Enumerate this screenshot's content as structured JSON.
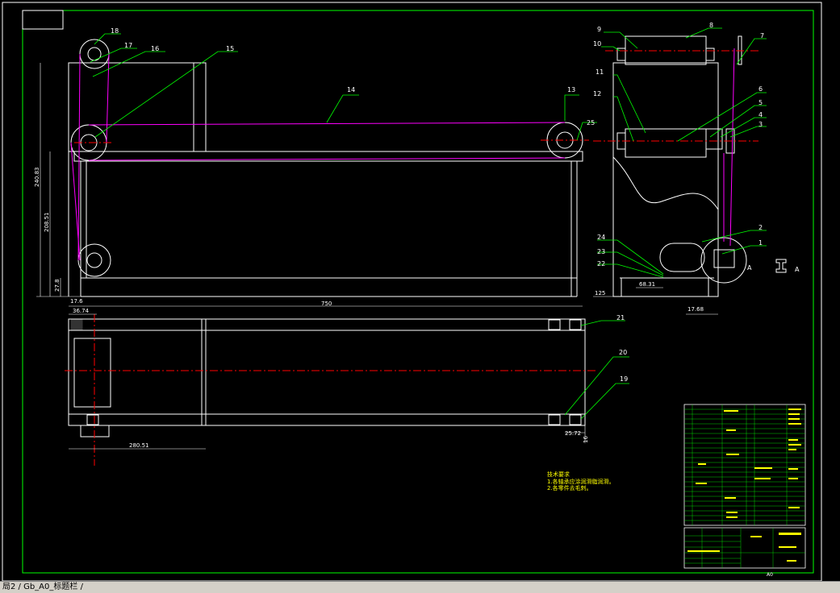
{
  "drawing": {
    "parts_labels": [
      "1",
      "2",
      "3",
      "4",
      "5",
      "6",
      "7",
      "8",
      "9",
      "10",
      "11",
      "12",
      "13",
      "14",
      "15",
      "16",
      "17",
      "18",
      "19",
      "20",
      "21",
      "22",
      "23",
      "24",
      "25"
    ],
    "dimensions": {
      "d_24083": "240.83",
      "d_20851": "208.51",
      "d_278": "27.8",
      "d_176": "17.6",
      "d_750": "750",
      "d_3674": "36.74",
      "d_6831": "68.31",
      "d_125": "125",
      "d_1768": "17.68",
      "d_28051": "280.51",
      "d_2572": "25.72",
      "d_16": "16"
    },
    "section_marks": {
      "left": "A",
      "right": "A"
    },
    "tech_title": "技术要求",
    "tech_line1": "1.各轴承应涂润滑脂润滑。",
    "tech_line2": "2.各零件去毛刺。",
    "sheet_mark": "A0"
  },
  "tabbar": {
    "tab_label": "局2 / Gb_A0_标题栏 /"
  },
  "colors": {
    "frame_green": "#00ff00",
    "belt_magenta": "#ff00ff",
    "centerline_red": "#ff0000",
    "leader_green": "#00ff00",
    "geometry_white": "#ffffff",
    "titleblock_yellow": "#ffff00"
  }
}
